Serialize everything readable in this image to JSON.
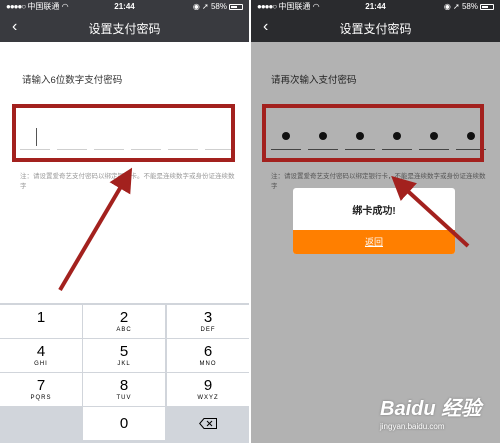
{
  "status_bar": {
    "carrier": "中国联通",
    "time": "21:44",
    "battery": "58%"
  },
  "left_screen": {
    "title": "设置支付密码",
    "prompt": "请输入6位数字支付密码",
    "note": "注：请设置爱奇艺支付密码以绑定银行卡。不能是连续数字或身份证连续数字",
    "pin_length": 6,
    "filled_digits": 0,
    "keypad": [
      {
        "num": "1",
        "sub": ""
      },
      {
        "num": "2",
        "sub": "ABC"
      },
      {
        "num": "3",
        "sub": "DEF"
      },
      {
        "num": "4",
        "sub": "GHI"
      },
      {
        "num": "5",
        "sub": "JKL"
      },
      {
        "num": "6",
        "sub": "MNO"
      },
      {
        "num": "7",
        "sub": "PQRS"
      },
      {
        "num": "8",
        "sub": "TUV"
      },
      {
        "num": "9",
        "sub": "WXYZ"
      }
    ],
    "zero_key": "0"
  },
  "right_screen": {
    "title": "设置支付密码",
    "prompt": "请再次输入支付密码",
    "note": "注：请设置爱奇艺支付密码以绑定银行卡，不能是连续数字或身份证连续数字",
    "pin_length": 6,
    "filled_digits": 6,
    "dialog": {
      "message": "绑卡成功!",
      "button": "返回"
    }
  },
  "watermark": {
    "brand": "Baidu 经验",
    "url": "jingyan.baidu.com"
  },
  "colors": {
    "navbar_left": "#393a3f",
    "navbar_right": "#2a2b2e",
    "annotation_red": "#a3211e",
    "dialog_button": "#ff7f00"
  }
}
